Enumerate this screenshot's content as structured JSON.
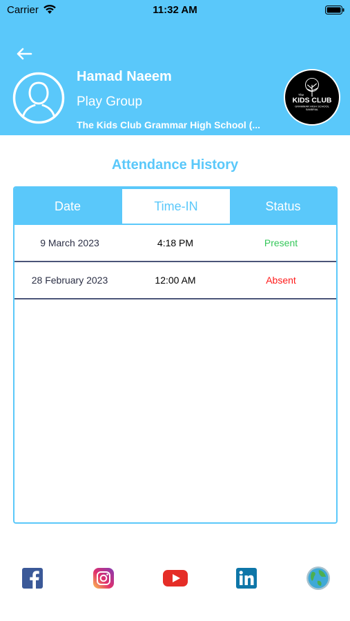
{
  "status_bar": {
    "carrier": "Carrier",
    "time": "11:32 AM"
  },
  "header": {
    "student_name": "Hamad Naeem",
    "class_name": "Play Group",
    "school_name": "The Kids Club Grammar High School (...",
    "logo": {
      "line1": "The",
      "line2": "KIDS CLUB",
      "line3": "GRAMMAR HIGH SCHOOL",
      "line4": "SAMBRIAL"
    }
  },
  "section_title": "Attendance History",
  "table": {
    "columns": [
      "Date",
      "Time-IN",
      "Status"
    ],
    "active_column": "Time-IN",
    "rows": [
      {
        "date": "9 March 2023",
        "time": "4:18 PM",
        "status": "Present"
      },
      {
        "date": "28 February 2023",
        "time": "12:00 AM",
        "status": "Absent"
      }
    ]
  },
  "colors": {
    "accent": "#5ac8fa",
    "present": "#34c759",
    "absent": "#ff1a1a"
  },
  "social_links": [
    "facebook-icon",
    "instagram-icon",
    "youtube-icon",
    "linkedin-icon",
    "globe-icon"
  ]
}
